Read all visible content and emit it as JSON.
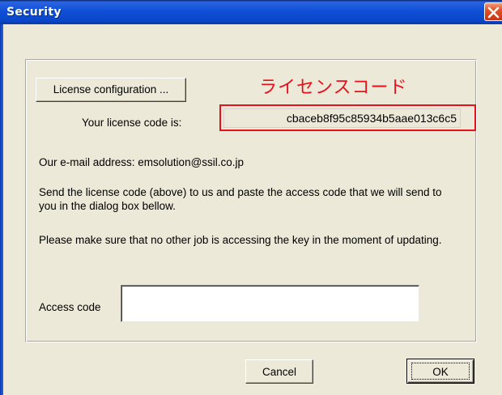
{
  "window": {
    "title": "Security"
  },
  "license": {
    "button_label": "License configuration ...",
    "code_label": "Your license  code is:",
    "code_value": "cbaceb8f95c85934b5aae013c6c5"
  },
  "annotation": {
    "text": "ライセンスコード",
    "color": "#e8101a"
  },
  "info": {
    "email_line": "Our e-mail address: emsolution@ssil.co.jp",
    "send_instructions": "Send the license code (above) to us and paste the access code that we will send to you in the dialog box bellow.",
    "update_warning": "Please make sure that no other job is accessing the key in the moment of updating."
  },
  "access": {
    "label": "Access code",
    "value": ""
  },
  "buttons": {
    "cancel": "Cancel",
    "ok": "OK"
  },
  "icons": {
    "close": "close-icon"
  }
}
